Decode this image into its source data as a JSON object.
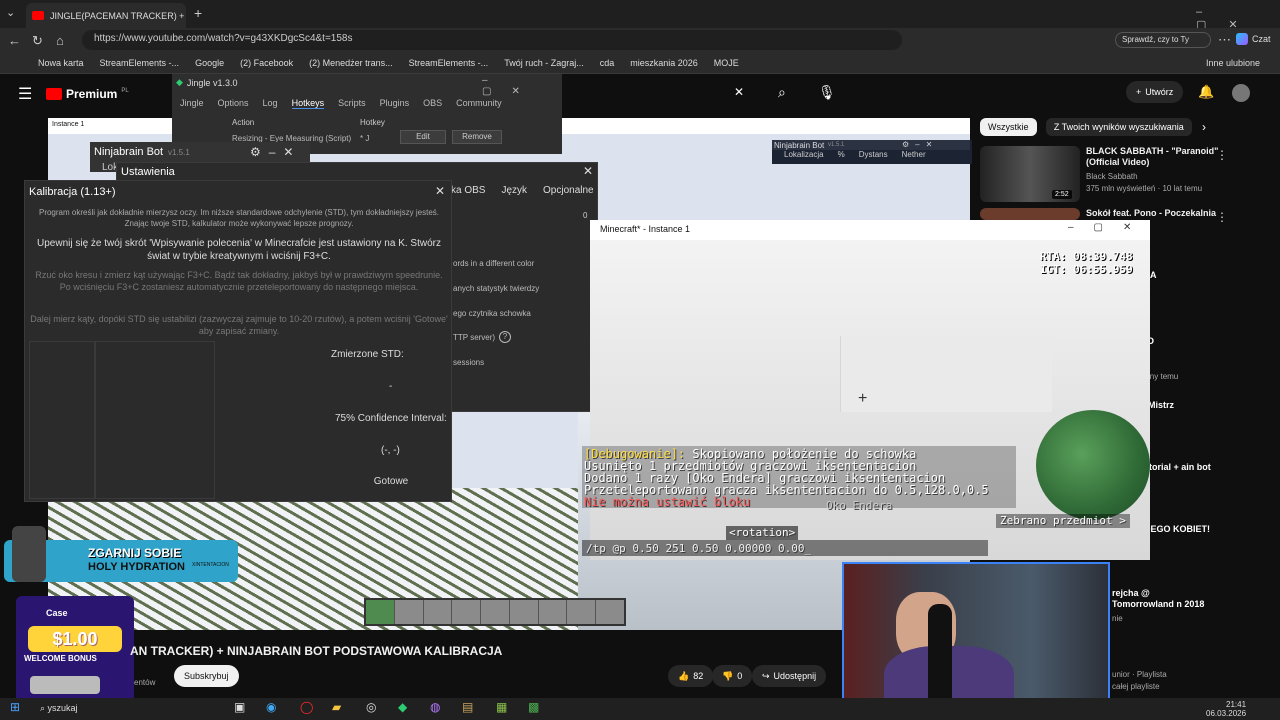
{
  "browser": {
    "tab_title": "JINGLE(PACEMAN TRACKER) + NI...",
    "url": "https://www.youtube.com/watch?v=g43XKDgcSc4&t=158s",
    "search_badge": "Sprawdź, czy to Ty",
    "brand": "Czat",
    "bookmarks": [
      "Nowa karta",
      "StreamElements -...",
      "Google",
      "(2) Facebook",
      "(2) Menedżer trans...",
      "StreamElements -...",
      "Twój ruch - Zagraj...",
      "cda",
      "mieszkania 2026",
      "MOJE"
    ],
    "bookmarks_other": "Inne ulubione"
  },
  "youtube": {
    "logo": "Premium",
    "logo_region": "PL",
    "create_label": "Utwórz",
    "chips": [
      "Wszystkie",
      "Z Twoich wyników wyszukiwania"
    ],
    "video_title": "AN TRACKER) + NINJABRAIN BOT PODSTAWOWA KALIBRACJA",
    "subscribe": "Subskrybuj",
    "views_short": "entów",
    "likes": "82",
    "dislikes": "0",
    "share": "Udostępnij",
    "inner_window_title": "Instance 1",
    "sidebar": [
      {
        "title": "BLACK SABBATH - \"Paranoid\" (Official Video)",
        "channel": "Black Sabbath",
        "meta": "375 mln wyświetleń · 10 lat temu",
        "duration": "2:52"
      },
      {
        "title": "Sokół feat. Pono - Poczekalnia",
        "channel": "",
        "meta": "",
        "duration": ""
      },
      {
        "title": "rtfel NA",
        "channel": "",
        "meta": "",
        "duration": ""
      },
      {
        "title": "ZIE DO",
        "channel": "",
        "meta": "4 godziny temu",
        "duration": ""
      },
      {
        "title": "arate Mistrz",
        "channel": "",
        "meta": "",
        "duration": ""
      },
      {
        "title": "tup tutorial + ain bot and ...",
        "channel": "",
        "meta": "",
        "duration": ""
      },
      {
        "title": "MŁODEGO KOBIET! ...",
        "channel": "",
        "meta": "",
        "duration": ""
      },
      {
        "title": "rejcha @ Tomorrowland n 2018",
        "channel": "",
        "meta": "nie",
        "duration": ""
      },
      {
        "title": "unior · Playlista",
        "channel": "",
        "meta": "całej playliste",
        "duration": ""
      }
    ]
  },
  "jingle": {
    "title": "Jingle v1.3.0",
    "tabs": [
      "Jingle",
      "Options",
      "Log",
      "Hotkeys",
      "Scripts",
      "Plugins",
      "OBS",
      "Community"
    ],
    "col_action": "Action",
    "col_hotkey": "Hotkey",
    "row_action": "Resizing - Eye Measuring (Script)",
    "row_hotkey": "* J",
    "edit": "Edit",
    "remove": "Remove"
  },
  "ninjabrain": {
    "title": "Ninjabrain Bot",
    "version": "v1.5.1",
    "partial": "Lok",
    "overlay_title": "Ninjabrain Bot",
    "overlay_cols": [
      "Lokalizacja",
      "%",
      "Dystans",
      "Nether"
    ]
  },
  "ustawienia": {
    "title": "Ustawienia",
    "tabs": [
      "ka OBS",
      "Język",
      "Opcjonalne"
    ],
    "value0": "0",
    "items": [
      "ords in a different color",
      "anych statystyk twierdzy",
      "ego czytnika schowka",
      "TTP server)",
      "sessions"
    ]
  },
  "kalibracja": {
    "title": "Kalibracja (1.13+)",
    "intro": "Program określi jak dokładnie mierzysz oczy. Im niższe standardowe odchylenie (STD), tym dokładniejszy jesteś. Znając twoje STD, kalkulator może wykonywać lepsze prognozy.",
    "step1": "Upewnij się że twój skrót 'Wpisywanie polecenia' w Minecrafcie jest ustawiony na K. Stwórz świat w trybie kreatywnym i wciśnij F3+C.",
    "step2": "Rzuć oko kresu i zmierz kąt używając F3+C. Bądź tak dokładny, jakbyś był w prawdziwym speedrunie. Po wciśnięciu F3+C zostaniesz automatycznie przeteleportowany do następnego miejsca.",
    "step3": "Dalej mierz kąty, dopóki STD się ustabilizi (zazwyczaj zajmuje to 10-20 rzutów), a potem wciśnij 'Gotowe' aby zapisać zmiany.",
    "std_label": "Zmierzone STD:",
    "std_value": "-",
    "ci_label": "75% Confidence Interval:",
    "ci_value": "(-, -)",
    "done": "Gotowe"
  },
  "minecraft": {
    "window_title": "Minecraft* - Instance 1",
    "rta": "RTA: 08:39.748",
    "igt": "IGT: 06:55.959",
    "chat": [
      {
        "prefix": "[Debugowanie]:",
        "text": " Skopiowano położenie do schowka"
      },
      {
        "prefix": "",
        "text": "Usunięto 1 przedmiotów graczowi iksententacion"
      },
      {
        "prefix": "",
        "text": "Dodano 1 razy [Oko Endera] graczowi iksententacion"
      },
      {
        "prefix": "",
        "text": "Przeteleportowano gracza iksententacion do 0.5,128.0,0.5"
      }
    ],
    "error": "Nie można ustawić bloku",
    "item_name": "Oko Endera",
    "picked": "Zebrano przedmiot >",
    "rotation": "<rotation>",
    "command": "/tp @p 0.50 251 0.50 0.00000 0.00_"
  },
  "ads": {
    "ad1_line1": "ZGARNIJ SOBIE",
    "ad1_line2": "HOLY HYDRATION",
    "ad1_brand": "XINTENTACION",
    "ad2_brand": "Case",
    "ad2_amount": "$1.00",
    "ad2_text": "WELCOME BONUS"
  },
  "taskbar": {
    "search": "yszukaj",
    "time": "21:41",
    "date": "06.03.2026"
  }
}
